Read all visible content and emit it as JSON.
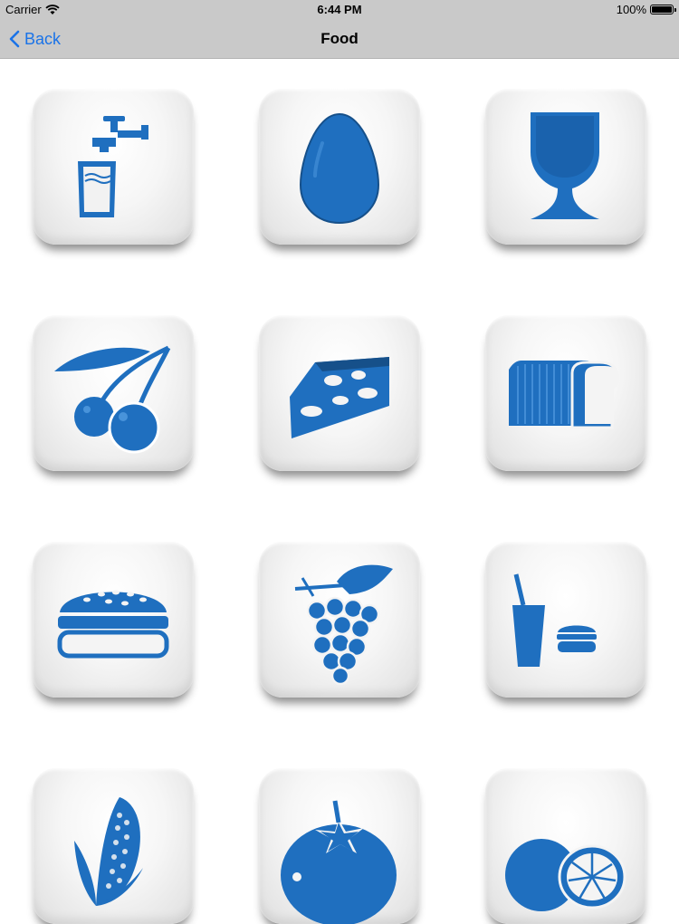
{
  "status_bar": {
    "carrier": "Carrier",
    "time": "6:44 PM",
    "battery": "100%"
  },
  "nav": {
    "back_label": "Back",
    "title": "Food"
  },
  "icon_color": "#1f6fbf",
  "tiles": [
    {
      "icon": "water-glass-icon"
    },
    {
      "icon": "egg-icon"
    },
    {
      "icon": "wine-glass-icon"
    },
    {
      "icon": "cherries-icon"
    },
    {
      "icon": "cheese-icon"
    },
    {
      "icon": "bread-loaf-icon"
    },
    {
      "icon": "hamburger-icon"
    },
    {
      "icon": "grapes-icon"
    },
    {
      "icon": "fast-food-icon"
    },
    {
      "icon": "corn-icon"
    },
    {
      "icon": "tomato-icon"
    },
    {
      "icon": "orange-icon"
    }
  ]
}
